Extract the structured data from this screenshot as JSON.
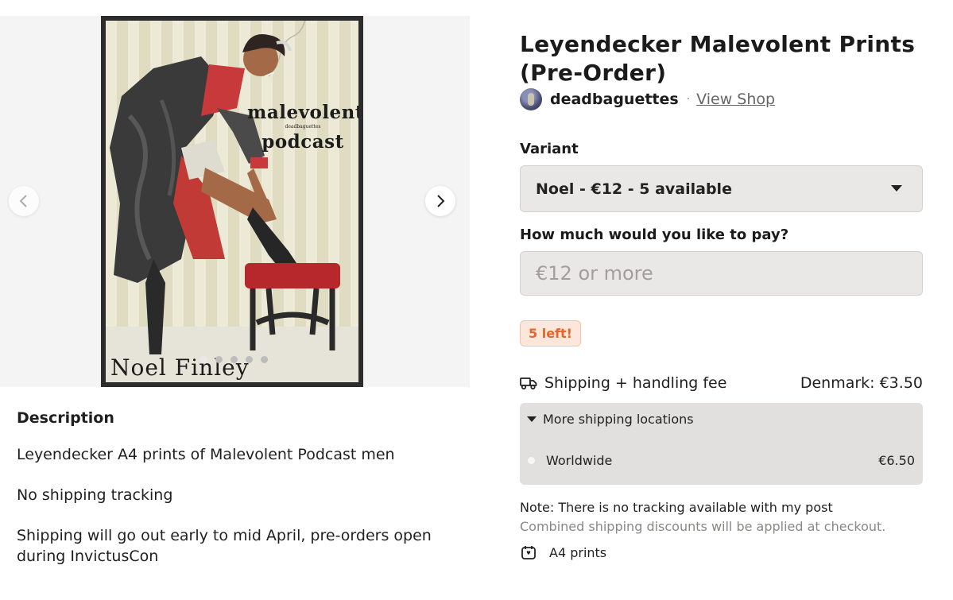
{
  "gallery": {
    "poster_title_line1": "malevolent",
    "poster_title_small": "deadbaguettes",
    "poster_title_line2": "podcast",
    "poster_name": "Noel Finley",
    "dots": 5,
    "active_dot": 0
  },
  "product": {
    "title": "Leyendecker Malevolent Prints (Pre-Order)",
    "shop_name": "deadbaguettes",
    "separator": "·",
    "view_shop_label": "View Shop"
  },
  "variant": {
    "label": "Variant",
    "selected": "Noel - €12 - 5 available"
  },
  "pay": {
    "label": "How much would you like to pay?",
    "placeholder": "€12 or more",
    "value": ""
  },
  "stock_badge": "5 left!",
  "shipping": {
    "label": "Shipping + handling fee",
    "destination": "Denmark: €3.50",
    "more_locations_label": "More shipping locations",
    "locations": [
      {
        "name": "Worldwide",
        "price": "€6.50"
      }
    ],
    "note": "Note: There is no tracking available with my post",
    "combined_note": "Combined shipping discounts will be applied at checkout."
  },
  "product_type": "A4 prints",
  "description": {
    "heading": "Description",
    "paragraphs": [
      "Leyendecker A4 prints of Malevolent Podcast men",
      "No shipping tracking",
      "Shipping will go out early to mid April, pre-orders open during InvictusCon"
    ]
  },
  "colors": {
    "badge_text": "#e8642a",
    "badge_bg": "#fde7da",
    "field_bg": "#e9e8e6"
  },
  "icons": [
    "chevron-left-icon",
    "chevron-right-icon",
    "truck-icon",
    "caret-down-icon",
    "gift-box-icon"
  ]
}
